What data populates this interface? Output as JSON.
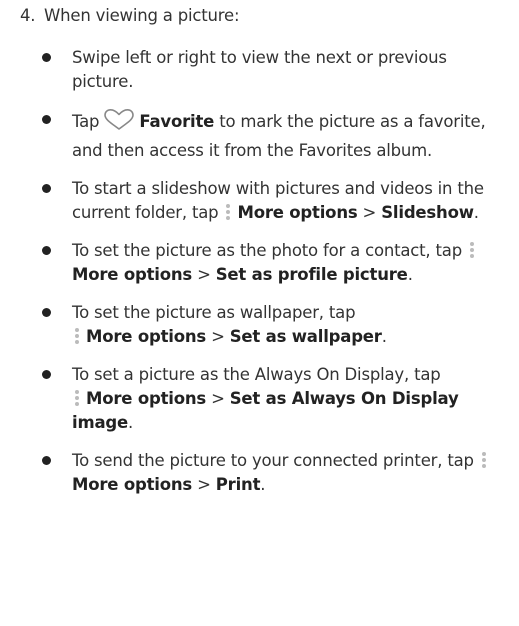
{
  "step": {
    "number": "4.",
    "text": "When viewing a picture:"
  },
  "icons": {
    "favorite": "heart-outline-icon",
    "more_options": "vertical-ellipsis-icon",
    "heart_color": "#888888",
    "dot_color": "#bbbbbb"
  },
  "bullets": [
    {
      "text": "Swipe left or right to view the next or previous picture."
    },
    {
      "pre": "Tap",
      "bold": "Favorite",
      "post": " to mark the picture as a favorite, and then access it from the Favorites album."
    },
    {
      "pre": "To start a slideshow with pictures and videos in the current folder, tap",
      "bold1": "More options",
      "sep": " > ",
      "bold2": "Slideshow",
      "post": "."
    },
    {
      "pre": "To set the picture as the photo for a contact, tap",
      "bold1": "More options",
      "sep": " > ",
      "bold2": "Set as profile picture",
      "post": "."
    },
    {
      "pre": "To set the picture as wallpaper, tap",
      "bold1": "More options",
      "sep": " > ",
      "bold2": "Set as wallpaper",
      "post": "."
    },
    {
      "pre": "To set a picture as the Always On Display, tap",
      "bold1": "More options",
      "sep": " > ",
      "bold2": "Set as Always On Display image",
      "post": "."
    },
    {
      "pre": "To send the picture to your connected printer, tap",
      "bold1": "More options",
      "sep": " > ",
      "bold2": "Print",
      "post": "."
    }
  ]
}
